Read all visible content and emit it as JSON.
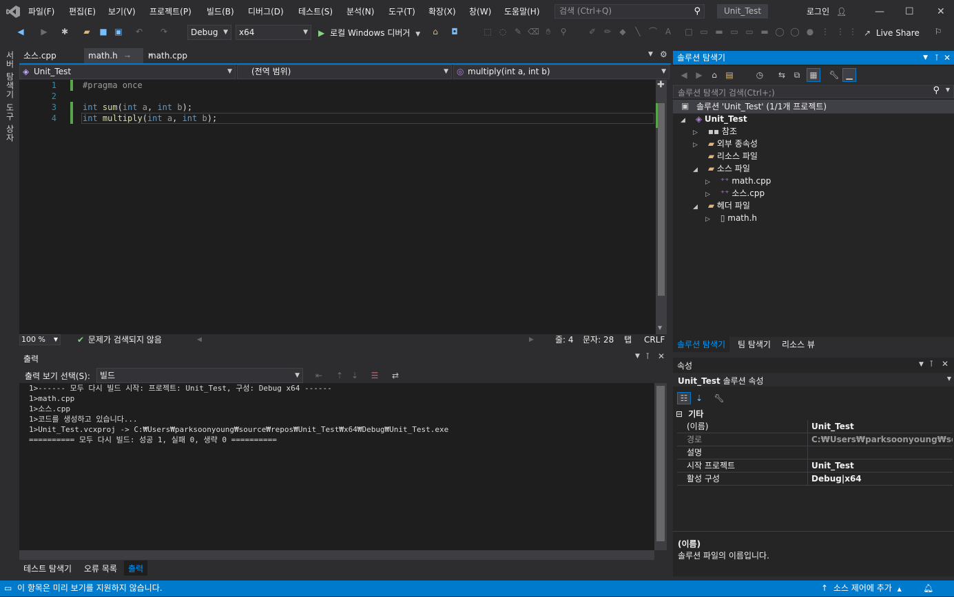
{
  "menu": {
    "items": [
      "파일(F)",
      "편집(E)",
      "보기(V)",
      "프로젝트(P)",
      "빌드(B)",
      "디버그(D)",
      "테스트(S)",
      "분석(N)",
      "도구(T)",
      "확장(X)",
      "창(W)",
      "도움말(H)"
    ],
    "search_placeholder": "검색 (Ctrl+Q)",
    "solution_name": "Unit_Test",
    "login": "로그인",
    "window_buttons": {
      "minimize": "—",
      "maximize": "☐",
      "close": "✕"
    }
  },
  "toolbar": {
    "config": "Debug",
    "platform": "x64",
    "run_label": "로컬 Windows 디버거",
    "live_share": "Live Share"
  },
  "left_sidebar": {
    "server_explorer": "서버 탐색기",
    "toolbox": "도구 상자"
  },
  "tabs": [
    {
      "label": "소스.cpp"
    },
    {
      "label": "math.h"
    },
    {
      "label": "math.cpp"
    }
  ],
  "navbar": {
    "project": "Unit_Test",
    "scope": "(전역 범위)",
    "member": "multiply(int a, int b)"
  },
  "code": {
    "line_numbers": [
      "1",
      "2",
      "3",
      "4"
    ],
    "line1": "#pragma once",
    "line3": {
      "type": "int",
      "name": "sum",
      "p1type": "int",
      "p1": "a",
      "p2type": "int",
      "p2": "b"
    },
    "line4": {
      "type": "int",
      "name": "multiply",
      "p1type": "int",
      "p1": "a",
      "p2type": "int",
      "p2": "b"
    }
  },
  "editor_status": {
    "zoom": "100 %",
    "issues": "문제가 검색되지 않음",
    "line": "줄: 4",
    "char": "문자: 28",
    "tab": "탭",
    "eol": "CRLF"
  },
  "output": {
    "title": "출력",
    "source_label": "출력 보기 선택(S):",
    "source_value": "빌드",
    "lines": [
      "1>------ 모두 다시 빌드 시작: 프로젝트: Unit_Test, 구성: Debug x64 ------",
      "1>math.cpp",
      "1>소스.cpp",
      "1>코드를 생성하고 있습니다...",
      "1>Unit_Test.vcxproj -> C:₩Users₩parksoonyoung₩source₩repos₩Unit_Test₩x64₩Debug₩Unit_Test.exe",
      "========== 모두 다시 빌드: 성공 1, 실패 0, 생략 0 =========="
    ]
  },
  "bottom_tabs": [
    "테스트 탐색기",
    "오류 목록",
    "출력"
  ],
  "solution_explorer": {
    "title": "솔루션 탐색기",
    "search_placeholder": "솔루션 탐색기 검색(Ctrl+;)",
    "solution": "솔루션 'Unit_Test' (1/1개 프로젝트)",
    "project": "Unit_Test",
    "nodes": [
      "참조",
      "외부 종속성",
      "리소스 파일",
      "소스 파일",
      "math.cpp",
      "소스.cpp",
      "헤더 파일",
      "math.h"
    ],
    "tabs": [
      "솔루션 탐색기",
      "팀 탐색기",
      "리소스 뷰"
    ]
  },
  "properties": {
    "title": "속성",
    "object": "Unit_Test",
    "object_type": "솔루션 속성",
    "category": "기타",
    "rows": [
      {
        "name": "(이름)",
        "value": "Unit_Test"
      },
      {
        "name": "경로",
        "value": "C:₩Users₩parksoonyoung₩source₩"
      },
      {
        "name": "설명",
        "value": ""
      },
      {
        "name": "시작 프로젝트",
        "value": "Unit_Test"
      },
      {
        "name": "활성 구성",
        "value": "Debug|x64"
      }
    ],
    "desc_title": "(이름)",
    "desc_text": "솔루션 파일의 이름입니다."
  },
  "statusbar": {
    "message": "이 항목은 미리 보기를 지원하지 않습니다.",
    "source_control": "소스 제어에 추가"
  },
  "colors": {
    "accent": "#007acc",
    "bg": "#2d2d30",
    "editor": "#1e1e1e",
    "keyword": "#569cd6",
    "function": "#dcdcaa",
    "linenum": "#2b91af"
  }
}
